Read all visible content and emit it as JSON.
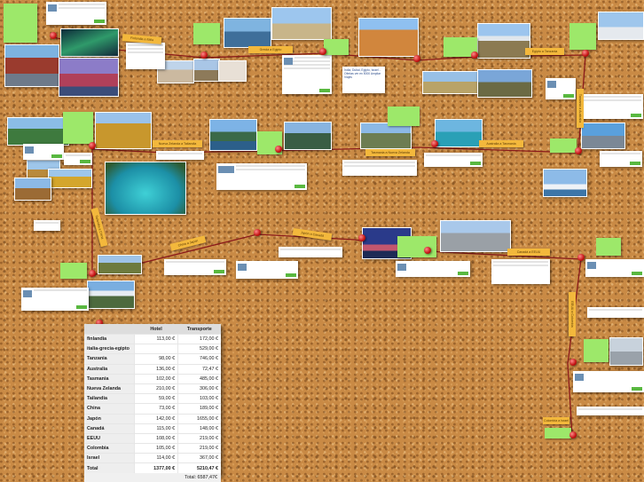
{
  "colors": {
    "cork": "#c98a45",
    "note": "#9de86a",
    "label": "#f3b83c",
    "pin": "#c31212",
    "route": "#8b1a1a"
  },
  "routes": [
    {
      "name": "Finlandia a Italia",
      "icon": "tape-label"
    },
    {
      "name": "Grecia a Egipto",
      "icon": "tape-label"
    },
    {
      "name": "Egipto a Tanzania",
      "icon": "tape-label"
    },
    {
      "name": "Tanzania a Australia",
      "icon": "tape-label"
    },
    {
      "name": "Australia a Tasmania",
      "icon": "tape-label"
    },
    {
      "name": "Tasmania a Nueva Zelanda",
      "icon": "tape-label"
    },
    {
      "name": "Nueva Zelanda a Tailandia",
      "icon": "tape-label"
    },
    {
      "name": "Tailandia a China",
      "icon": "tape-label"
    },
    {
      "name": "China a Japón",
      "icon": "tape-label"
    },
    {
      "name": "Japón a Canadá",
      "icon": "tape-label"
    },
    {
      "name": "Canadá a EEUU",
      "icon": "tape-label"
    },
    {
      "name": "EEUU a Colombia",
      "icon": "tape-label"
    },
    {
      "name": "Colombia a Israel",
      "icon": "tape-label"
    }
  ],
  "travel_note": "India, Dubai, Egipto, Israel - Ofertas ver en 5000 Ampliar Viajes",
  "table": {
    "headers": [
      "",
      "Hotel",
      "Transporte"
    ],
    "rows": [
      {
        "name": "finlandia",
        "hotel": "113,00 €",
        "transport": "172,00 €"
      },
      {
        "name": "italia-grecia-egipto",
        "hotel": "",
        "transport": "529,00 €"
      },
      {
        "name": "Tanzania",
        "hotel": "98,00 €",
        "transport": "746,00 €"
      },
      {
        "name": "Australia",
        "hotel": "136,00 €",
        "transport": "72,47 €"
      },
      {
        "name": "Tasmania",
        "hotel": "102,00 €",
        "transport": "485,00 €"
      },
      {
        "name": "Nueva Zelanda",
        "hotel": "210,00 €",
        "transport": "306,00 €"
      },
      {
        "name": "Tailandia",
        "hotel": "59,00 €",
        "transport": "103,00 €"
      },
      {
        "name": "China",
        "hotel": "73,00 €",
        "transport": "189,00 €"
      },
      {
        "name": "Japón",
        "hotel": "142,00 €",
        "transport": "1655,00 €"
      },
      {
        "name": "Canadá",
        "hotel": "115,00 €",
        "transport": "148,00 €"
      },
      {
        "name": "EEUU",
        "hotel": "108,00 €",
        "transport": "219,00 €"
      },
      {
        "name": "Colombia",
        "hotel": "105,00 €",
        "transport": "219,00 €"
      },
      {
        "name": "Israel",
        "hotel": "114,00 €",
        "transport": "367,00 €"
      }
    ],
    "total": {
      "name": "Total",
      "hotel": "1377,00 €",
      "transport": "5210,47 €"
    },
    "grand_total": "Total: 6587,47€"
  }
}
